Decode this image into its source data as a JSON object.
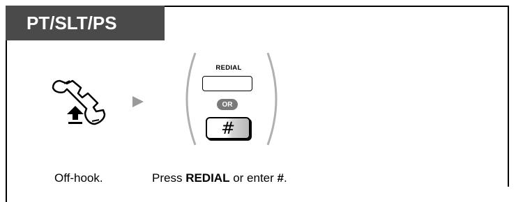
{
  "header": {
    "title": "PT/SLT/PS"
  },
  "step1": {
    "icon": "off-hook-handset-icon",
    "caption": "Off-hook."
  },
  "step2": {
    "redial_label": "REDIAL",
    "or_label": "OR",
    "hash_key": "#",
    "caption_prefix": "Press ",
    "caption_bold_1": "REDIAL",
    "caption_mid": " or enter ",
    "caption_bold_2": "#",
    "caption_suffix": "."
  },
  "colors": {
    "header_bg": "#4a4a4a",
    "arrow": "#9a9a9a",
    "or_badge": "#7a7a7a"
  }
}
